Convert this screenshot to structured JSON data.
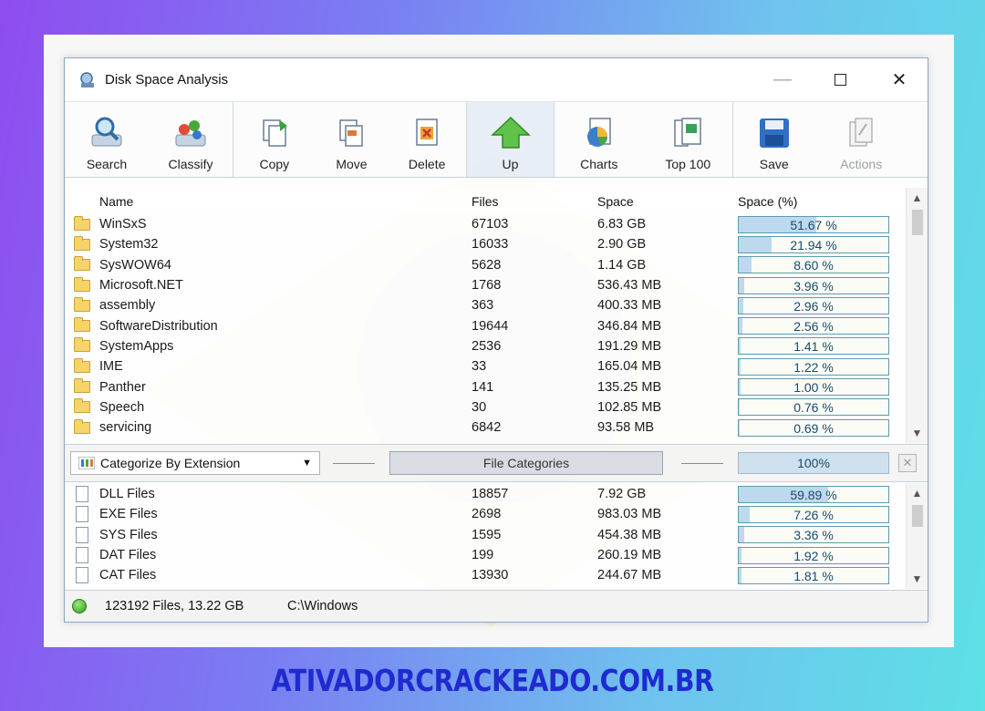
{
  "window": {
    "title": "Disk Space Analysis"
  },
  "toolbar": {
    "buttons": [
      {
        "label": "Search",
        "icon": "search-icon"
      },
      {
        "label": "Classify",
        "icon": "classify-icon"
      },
      {
        "label": "Copy",
        "icon": "copy-icon"
      },
      {
        "label": "Move",
        "icon": "move-icon"
      },
      {
        "label": "Delete",
        "icon": "delete-icon"
      },
      {
        "label": "Up",
        "icon": "up-arrow-icon"
      },
      {
        "label": "Charts",
        "icon": "pie-chart-icon"
      },
      {
        "label": "Top 100",
        "icon": "top100-icon"
      },
      {
        "label": "Save",
        "icon": "save-icon"
      },
      {
        "label": "Actions",
        "icon": "actions-icon"
      }
    ]
  },
  "columns": {
    "name": "Name",
    "files": "Files",
    "space": "Space",
    "pct": "Space (%)"
  },
  "folders": [
    {
      "name": "WinSxS",
      "files": "67103",
      "space": "6.83 GB",
      "pct": "51.67 %",
      "fill": 0.5167
    },
    {
      "name": "System32",
      "files": "16033",
      "space": "2.90 GB",
      "pct": "21.94 %",
      "fill": 0.2194
    },
    {
      "name": "SysWOW64",
      "files": "5628",
      "space": "1.14 GB",
      "pct": "8.60 %",
      "fill": 0.086
    },
    {
      "name": "Microsoft.NET",
      "files": "1768",
      "space": "536.43 MB",
      "pct": "3.96 %",
      "fill": 0.0396
    },
    {
      "name": "assembly",
      "files": "363",
      "space": "400.33 MB",
      "pct": "2.96 %",
      "fill": 0.0296
    },
    {
      "name": "SoftwareDistribution",
      "files": "19644",
      "space": "346.84 MB",
      "pct": "2.56 %",
      "fill": 0.0256
    },
    {
      "name": "SystemApps",
      "files": "2536",
      "space": "191.29 MB",
      "pct": "1.41 %",
      "fill": 0.0141
    },
    {
      "name": "IME",
      "files": "33",
      "space": "165.04 MB",
      "pct": "1.22 %",
      "fill": 0.0122
    },
    {
      "name": "Panther",
      "files": "141",
      "space": "135.25 MB",
      "pct": "1.00 %",
      "fill": 0.01
    },
    {
      "name": "Speech",
      "files": "30",
      "space": "102.85 MB",
      "pct": "0.76 %",
      "fill": 0.0076
    },
    {
      "name": "servicing",
      "files": "6842",
      "space": "93.58 MB",
      "pct": "0.69 %",
      "fill": 0.0069
    }
  ],
  "categorize": {
    "select": "Categorize By Extension",
    "center": "File Categories",
    "total": "100%"
  },
  "categories": [
    {
      "name": "DLL Files",
      "files": "18857",
      "space": "7.92 GB",
      "pct": "59.89 %",
      "fill": 0.5989,
      "icon": "dll-file-icon"
    },
    {
      "name": "EXE Files",
      "files": "2698",
      "space": "983.03 MB",
      "pct": "7.26 %",
      "fill": 0.0726,
      "icon": "exe-file-icon"
    },
    {
      "name": "SYS Files",
      "files": "1595",
      "space": "454.38 MB",
      "pct": "3.36 %",
      "fill": 0.0336,
      "icon": "sys-file-icon"
    },
    {
      "name": "DAT Files",
      "files": "199",
      "space": "260.19 MB",
      "pct": "1.92 %",
      "fill": 0.0192,
      "icon": "dat-file-icon"
    },
    {
      "name": "CAT Files",
      "files": "13930",
      "space": "244.67 MB",
      "pct": "1.81 %",
      "fill": 0.0181,
      "icon": "cat-file-icon"
    }
  ],
  "status": {
    "summary": "123192 Files, 13.22 GB",
    "path": "C:\\Windows"
  },
  "site": "ATIVADORCRACKEADO.COM.BR"
}
